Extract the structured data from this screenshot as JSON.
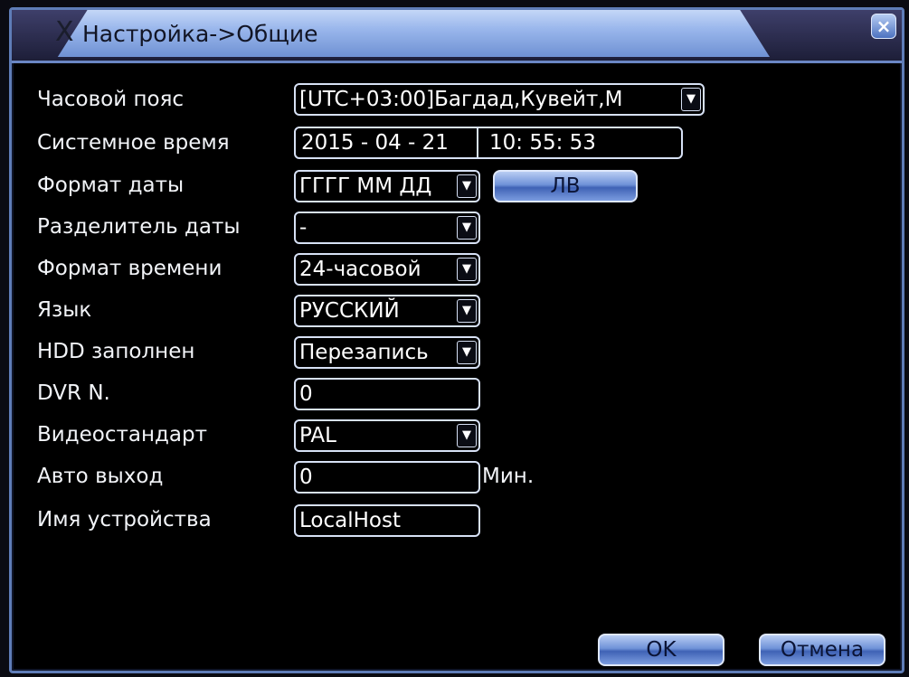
{
  "window": {
    "title": "Настройка->Общие",
    "title_icon": "Ⅹ",
    "close_label": "×"
  },
  "fields": {
    "timezone": {
      "label": "Часовой пояс",
      "value": "[UTC+03:00]Багдад,Кувейт,М"
    },
    "system_time": {
      "label": "Системное время",
      "date": "2015 - 04 - 21",
      "time": "10: 55: 53"
    },
    "date_format": {
      "label": "Формат даты",
      "value": "ГГГГ ММ ДД"
    },
    "date_separator": {
      "label": "Разделитель даты",
      "value": "-"
    },
    "time_format": {
      "label": "Формат времени",
      "value": "24-часовой"
    },
    "language": {
      "label": "Язык",
      "value": "РУССКИЙ"
    },
    "hdd_full": {
      "label": "HDD заполнен",
      "value": "Перезапись"
    },
    "dvr_no": {
      "label": "DVR N.",
      "value": "0"
    },
    "video_standard": {
      "label": "Видеостандарт",
      "value": "PAL"
    },
    "auto_logout": {
      "label": "Авто выход",
      "value": "0",
      "unit": "Мин."
    },
    "device_name": {
      "label": "Имя устройства",
      "value": "LocalHost"
    }
  },
  "buttons": {
    "dst": "ЛВ",
    "ok": "OK",
    "cancel": "Отмена"
  },
  "icons": {
    "dropdown": "▼"
  },
  "colors": {
    "title_gradient_top": "#c4d7f7",
    "title_gradient_bottom": "#6f91d3",
    "border": "#5f7db8",
    "background": "#000000"
  }
}
